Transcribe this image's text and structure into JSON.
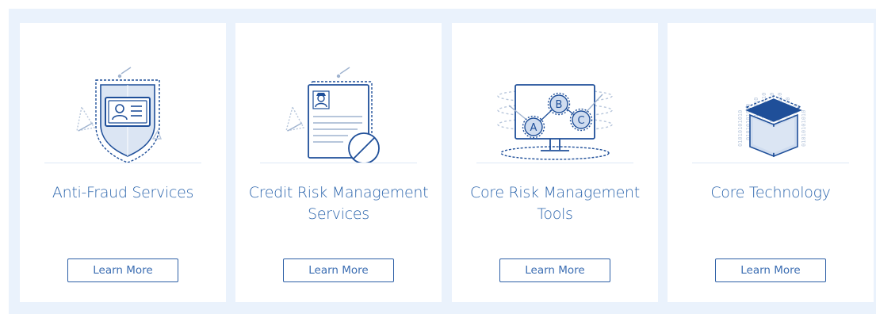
{
  "colors": {
    "accent": "#2d66ad",
    "panel_background": "#eaf2fc",
    "card_background": "#ffffff",
    "icon_stroke": "#1f4f99",
    "icon_fill": "#cfdcef"
  },
  "cards": [
    {
      "title": "Anti-Fraud Services",
      "icon": "shield-id-card-icon",
      "button_label": "Learn More"
    },
    {
      "title": "Credit Risk Management Services",
      "icon": "document-no-entry-icon",
      "button_label": "Learn More"
    },
    {
      "title": "Core Risk Management Tools",
      "icon": "monitor-network-icon",
      "button_label": "Learn More"
    },
    {
      "title": "Core Technology",
      "icon": "binary-cube-icon",
      "button_label": "Learn More"
    }
  ],
  "icon_text": {
    "node_a": "A",
    "node_b": "B",
    "node_c": "C",
    "binary_column": "01010101010"
  }
}
